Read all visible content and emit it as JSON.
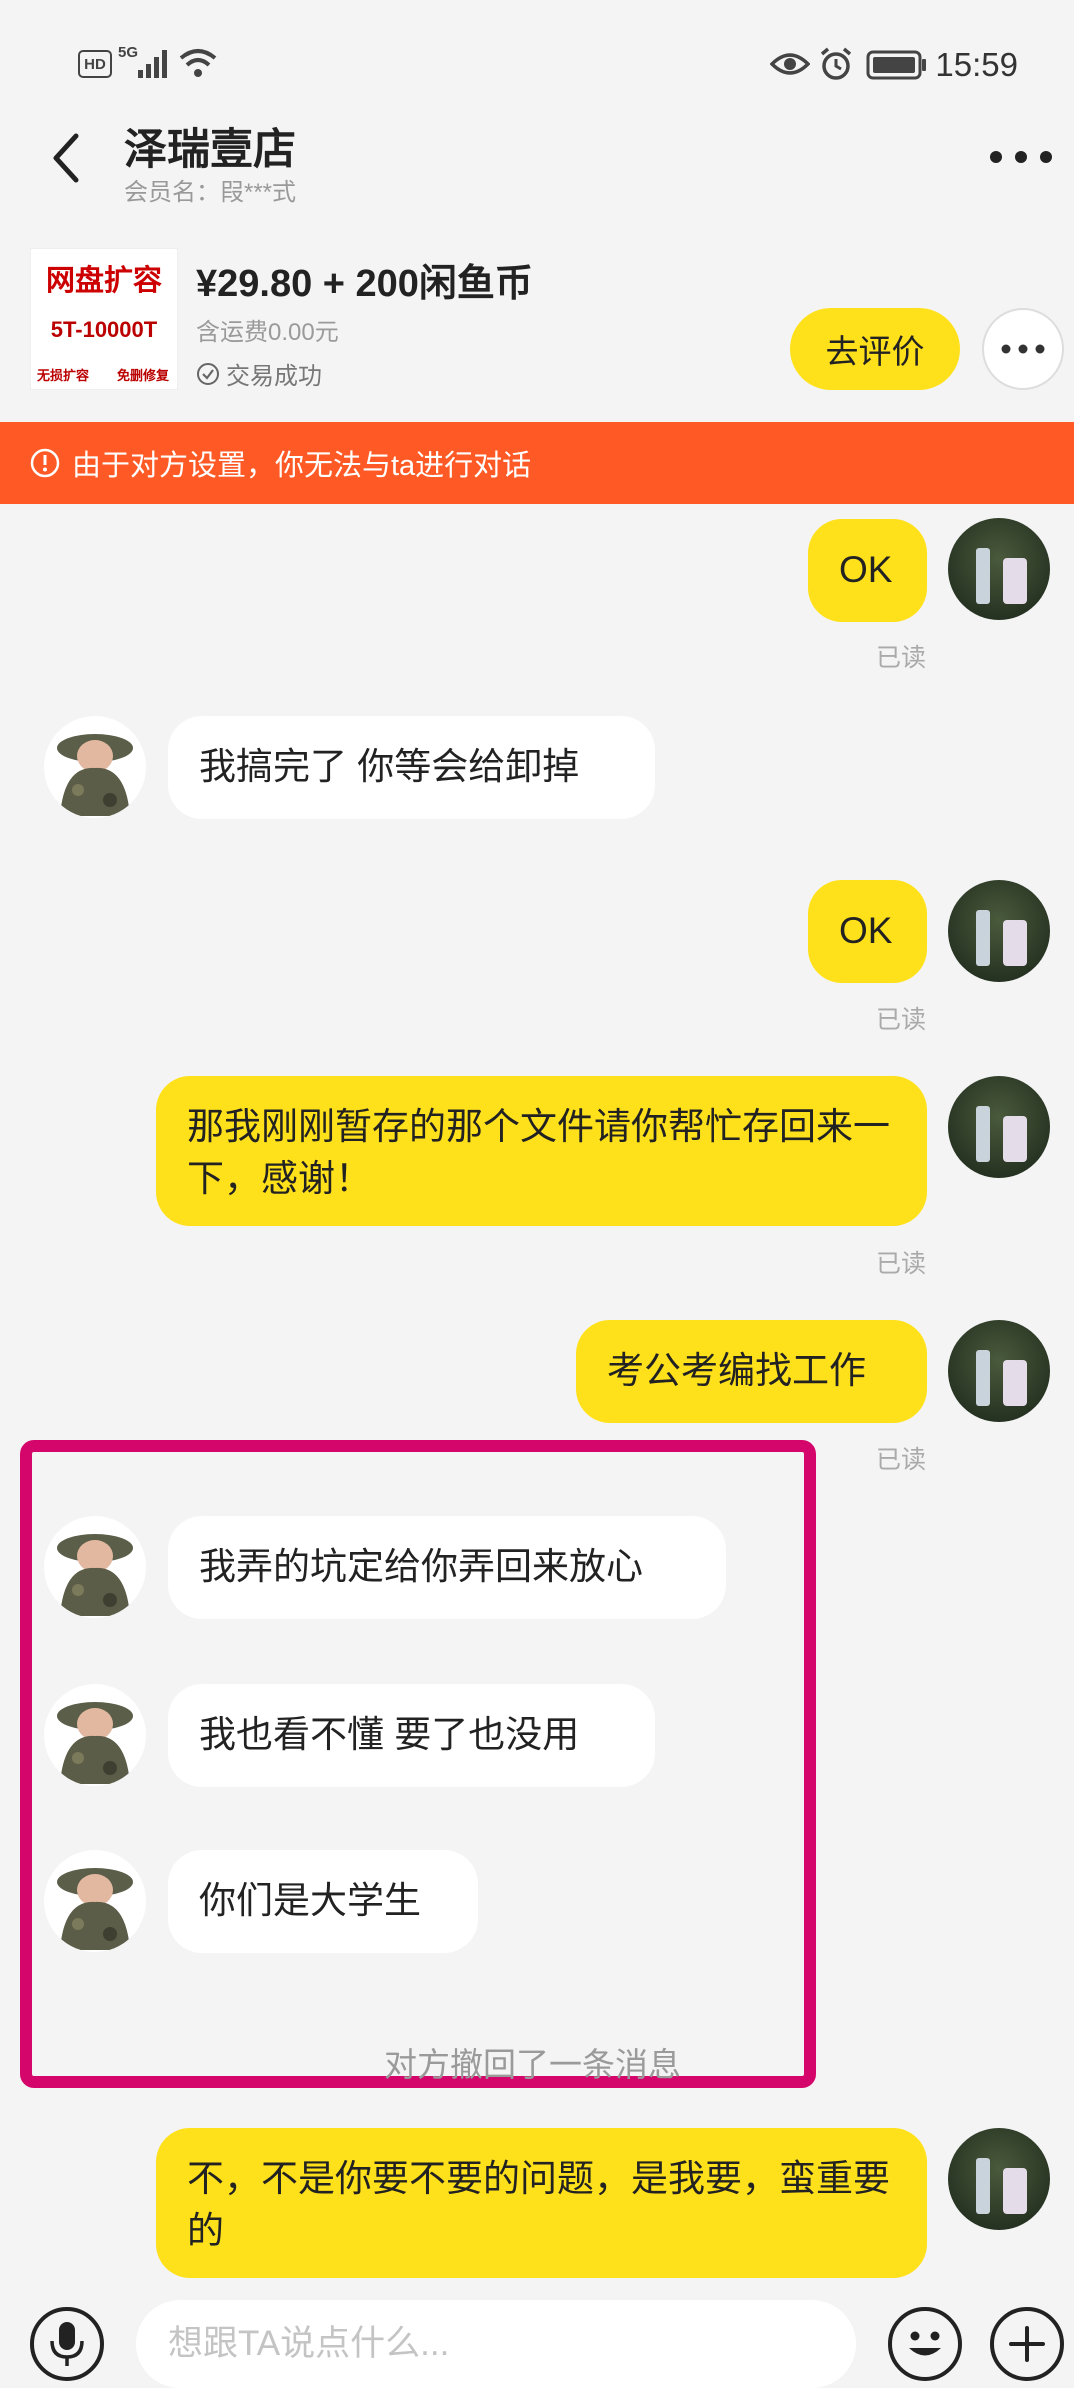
{
  "status_bar": {
    "network_badge": "HD",
    "network_type": "5G",
    "time": "15:59"
  },
  "header": {
    "shop_name": "泽瑞壹店",
    "member_label": "会员名：叚***式"
  },
  "product": {
    "image_title": "网盘扩容",
    "image_subtitle": "5T-10000T",
    "image_tag_left": "无损扩容",
    "image_tag_right": "免删修复",
    "price": "¥29.80 + 200闲鱼币",
    "shipping": "含运费0.00元",
    "trade_status": "交易成功",
    "review_button": "去评价"
  },
  "banner": {
    "text": "由于对方设置，你无法与ta进行对话"
  },
  "messages": [
    {
      "sender": "me",
      "text": "OK",
      "read": "已读"
    },
    {
      "sender": "them",
      "text": "我搞完了 你等会给卸掉"
    },
    {
      "sender": "me",
      "text": "OK",
      "read": "已读"
    },
    {
      "sender": "me",
      "text": "那我刚刚暂存的那个文件请你帮忙存回来一下，感谢！",
      "read": "已读"
    },
    {
      "sender": "me",
      "text": "考公考编找工作",
      "read": "已读"
    },
    {
      "sender": "them",
      "text": "我弄的坑定给你弄回来放心"
    },
    {
      "sender": "them",
      "text": "我也看不懂 要了也没用"
    },
    {
      "sender": "them",
      "text": "你们是大学生"
    },
    {
      "sender": "system",
      "text": "对方撤回了一条消息"
    },
    {
      "sender": "me",
      "text": "不，不是你要不要的问题，是我要，蛮重要的"
    }
  ],
  "input": {
    "placeholder": "想跟TA说点什么..."
  },
  "colors": {
    "accent_yellow": "#ffe11b",
    "banner_orange": "#ff5a25",
    "highlight_magenta": "#d4066b"
  }
}
